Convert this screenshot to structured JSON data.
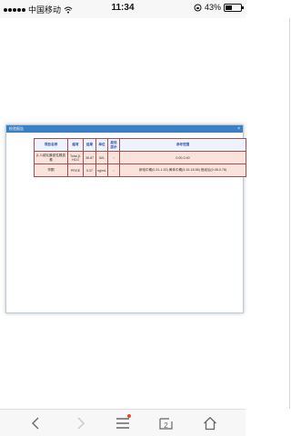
{
  "status": {
    "carrier": "中国移动",
    "time": "11:34",
    "battery_percent": "43%",
    "battery_level": 0.43
  },
  "dialog": {
    "title": "检验报告",
    "close_glyph": "×",
    "headers": [
      "项目名称",
      "缩写",
      "结果",
      "单位",
      "高低提示",
      "参考范围"
    ],
    "rows": [
      {
        "name": "β-人绒毛膜促性腺激素",
        "abbr": "Total-β-HCG",
        "result": "36.87",
        "unit": "IU/L",
        "flag": "↑",
        "reference": "0.00-0.40"
      },
      {
        "name": "孕酮",
        "abbr": "PRGE",
        "result": "5.37",
        "unit": "ng/mL",
        "flag": "↑",
        "reference": "卵泡中期(0.31-1.52) 黄体中期(5.16-18.56) 绝经后(0.08-0.78)"
      }
    ]
  },
  "toolbar": {
    "tab_count": "2"
  }
}
